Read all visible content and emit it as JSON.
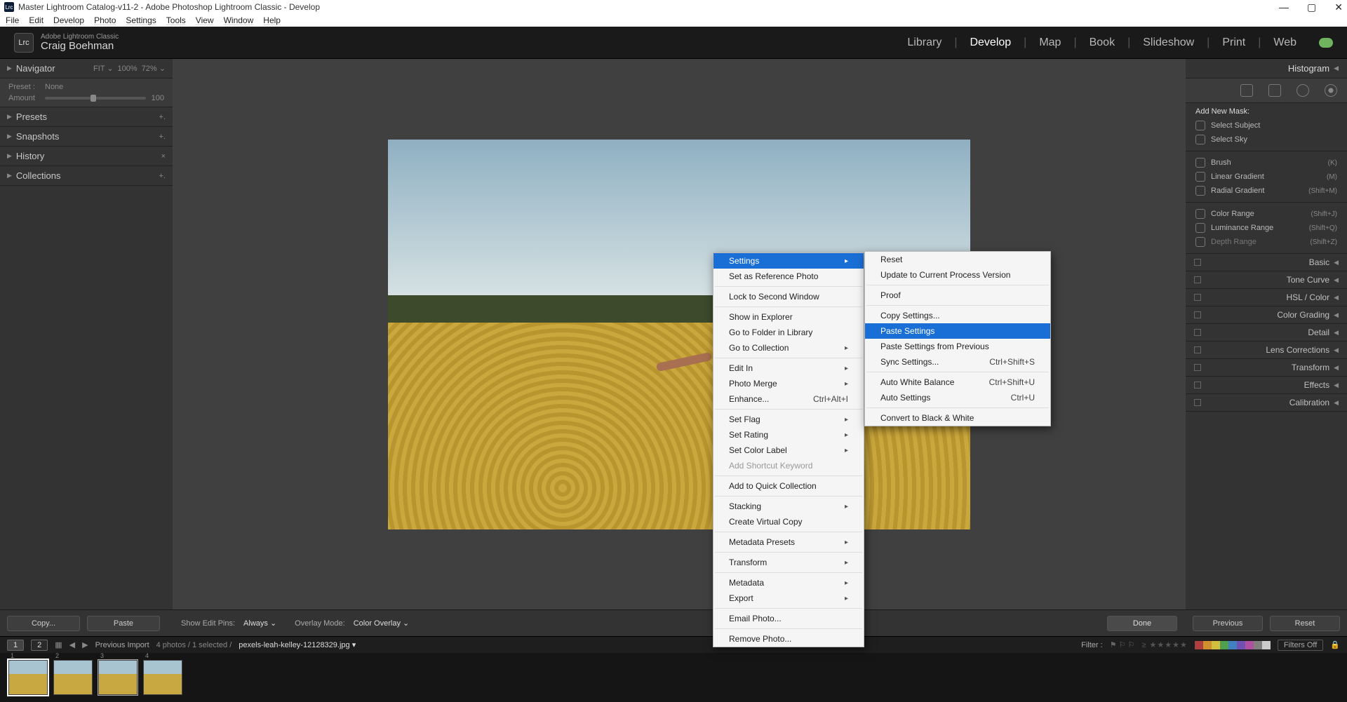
{
  "titlebar": {
    "text": "Master Lightroom Catalog-v11-2 - Adobe Photoshop Lightroom Classic - Develop",
    "logo": "Lrc"
  },
  "menubar": [
    "File",
    "Edit",
    "Develop",
    "Photo",
    "Settings",
    "Tools",
    "View",
    "Window",
    "Help"
  ],
  "identity": {
    "product": "Adobe Lightroom Classic",
    "user": "Craig Boehman",
    "logo": "Lrc"
  },
  "modules": [
    "Library",
    "Develop",
    "Map",
    "Book",
    "Slideshow",
    "Print",
    "Web"
  ],
  "modules_active": "Develop",
  "left": {
    "navigator": {
      "title": "Navigator",
      "fit": "FIT",
      "zoom1": "100%",
      "zoom2": "72%"
    },
    "preset_row": {
      "preset_label": "Preset :",
      "preset_value": "None",
      "amount_label": "Amount",
      "amount_value": "100"
    },
    "sections": [
      "Presets",
      "Snapshots",
      "History",
      "Collections"
    ]
  },
  "center_bottom": {
    "copy": "Copy...",
    "paste": "Paste",
    "show_pins": "Show Edit Pins:",
    "show_pins_val": "Always",
    "overlay_mode": "Overlay Mode:",
    "overlay_val": "Color Overlay",
    "done": "Done",
    "previous": "Previous",
    "reset": "Reset"
  },
  "right": {
    "histogram": "Histogram",
    "mask_title": "Add New Mask:",
    "mask_items": [
      {
        "label": "Select Subject",
        "short": ""
      },
      {
        "label": "Select Sky",
        "short": ""
      }
    ],
    "tool_items": [
      {
        "label": "Brush",
        "short": "(K)"
      },
      {
        "label": "Linear Gradient",
        "short": "(M)"
      },
      {
        "label": "Radial Gradient",
        "short": "(Shift+M)"
      }
    ],
    "more_items": [
      {
        "label": "Color Range",
        "short": "(Shift+J)"
      },
      {
        "label": "Luminance Range",
        "short": "(Shift+Q)"
      },
      {
        "label": "Depth Range",
        "short": "(Shift+Z)"
      }
    ],
    "panels": [
      "Basic",
      "Tone Curve",
      "HSL / Color",
      "Color Grading",
      "Detail",
      "Lens Corrections",
      "Transform",
      "Effects",
      "Calibration"
    ]
  },
  "filmbar": {
    "pill1": "1",
    "pill2": "2",
    "source": "Previous Import",
    "count": "4 photos / 1 selected /",
    "filename": "pexels-leah-kelley-12128329.jpg",
    "filter_label": "Filter :",
    "filters_off": "Filters Off"
  },
  "swatches": [
    "#b04040",
    "#d09030",
    "#d0c040",
    "#50a050",
    "#4080c0",
    "#7050b0",
    "#b050a0",
    "#808080",
    "#cccccc"
  ],
  "context1": [
    {
      "label": "Settings",
      "type": "hl-arrow"
    },
    {
      "label": "Set as Reference Photo"
    },
    {
      "type": "sep"
    },
    {
      "label": "Lock to Second Window"
    },
    {
      "type": "sep"
    },
    {
      "label": "Show in Explorer"
    },
    {
      "label": "Go to Folder in Library"
    },
    {
      "label": "Go to Collection",
      "type": "arrow"
    },
    {
      "type": "sep"
    },
    {
      "label": "Edit In",
      "type": "arrow"
    },
    {
      "label": "Photo Merge",
      "type": "arrow"
    },
    {
      "label": "Enhance...",
      "short": "Ctrl+Alt+I"
    },
    {
      "type": "sep"
    },
    {
      "label": "Set Flag",
      "type": "arrow"
    },
    {
      "label": "Set Rating",
      "type": "arrow"
    },
    {
      "label": "Set Color Label",
      "type": "arrow"
    },
    {
      "label": "Add Shortcut Keyword",
      "type": "disabled"
    },
    {
      "type": "sep"
    },
    {
      "label": "Add to Quick Collection"
    },
    {
      "type": "sep"
    },
    {
      "label": "Stacking",
      "type": "arrow"
    },
    {
      "label": "Create Virtual Copy"
    },
    {
      "type": "sep"
    },
    {
      "label": "Metadata Presets",
      "type": "arrow"
    },
    {
      "type": "sep"
    },
    {
      "label": "Transform",
      "type": "arrow"
    },
    {
      "type": "sep"
    },
    {
      "label": "Metadata",
      "type": "arrow"
    },
    {
      "label": "Export",
      "type": "arrow"
    },
    {
      "type": "sep"
    },
    {
      "label": "Email Photo..."
    },
    {
      "type": "sep"
    },
    {
      "label": "Remove Photo..."
    }
  ],
  "context2": [
    {
      "label": "Reset"
    },
    {
      "label": "Update to Current Process Version"
    },
    {
      "type": "sep"
    },
    {
      "label": "Proof"
    },
    {
      "type": "sep"
    },
    {
      "label": "Copy Settings..."
    },
    {
      "label": "Paste Settings",
      "type": "hl"
    },
    {
      "label": "Paste Settings from Previous"
    },
    {
      "label": "Sync Settings...",
      "short": "Ctrl+Shift+S"
    },
    {
      "type": "sep"
    },
    {
      "label": "Auto White Balance",
      "short": "Ctrl+Shift+U"
    },
    {
      "label": "Auto Settings",
      "short": "Ctrl+U"
    },
    {
      "type": "sep"
    },
    {
      "label": "Convert to Black & White"
    }
  ]
}
